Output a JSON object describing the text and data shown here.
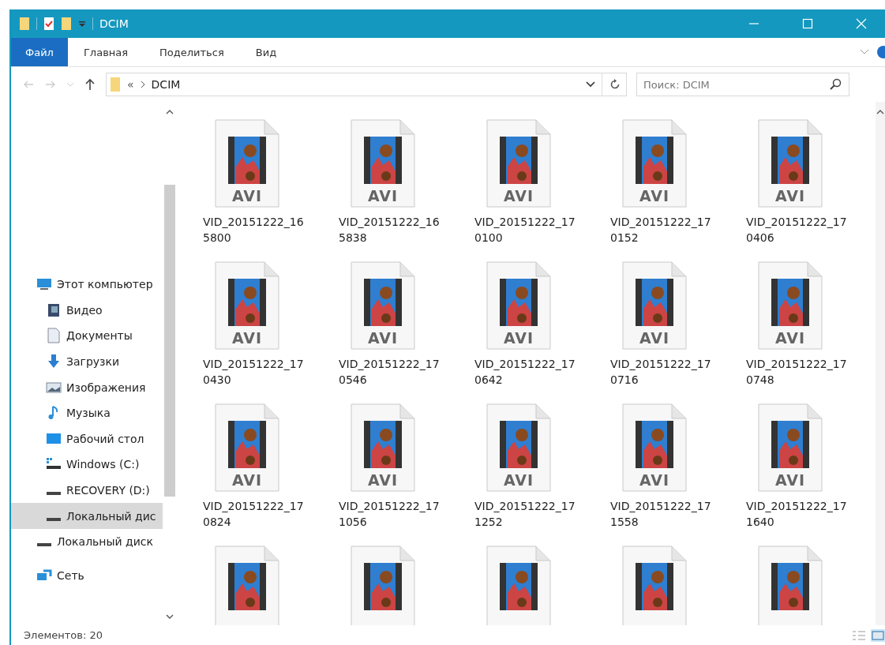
{
  "window": {
    "title": "DCIM"
  },
  "ribbon_tabs": [
    {
      "label": "Файл",
      "selected": true
    },
    {
      "label": "Главная",
      "selected": false
    },
    {
      "label": "Поделиться",
      "selected": false
    },
    {
      "label": "Вид",
      "selected": false
    }
  ],
  "address": {
    "overflow": "«",
    "path": "DCIM"
  },
  "search": {
    "placeholder": "Поиск: DCIM"
  },
  "sidebar": {
    "items": [
      {
        "label": "Этот компьютер",
        "kind": "computer",
        "selected": false,
        "children": [
          {
            "label": "Видео",
            "kind": "video",
            "selected": false
          },
          {
            "label": "Документы",
            "kind": "documents",
            "selected": false
          },
          {
            "label": "Загрузки",
            "kind": "downloads",
            "selected": false
          },
          {
            "label": "Изображения",
            "kind": "pictures",
            "selected": false
          },
          {
            "label": "Музыка",
            "kind": "music",
            "selected": false
          },
          {
            "label": "Рабочий стол",
            "kind": "desktop",
            "selected": false
          },
          {
            "label": "Windows (C:)",
            "kind": "system-drive",
            "selected": false
          },
          {
            "label": "RECOVERY (D:)",
            "kind": "drive",
            "selected": false
          },
          {
            "label": "Локальный дис",
            "kind": "drive",
            "selected": true
          }
        ]
      },
      {
        "label": "Локальный диск",
        "kind": "drive",
        "selected": false
      },
      {
        "label": "Сеть",
        "kind": "network",
        "selected": false
      }
    ]
  },
  "files": [
    {
      "kind": "video",
      "name": "VID_20151222_165800",
      "badge": "AVI"
    },
    {
      "kind": "video",
      "name": "VID_20151222_165838",
      "badge": "AVI"
    },
    {
      "kind": "video",
      "name": "VID_20151222_170100",
      "badge": "AVI"
    },
    {
      "kind": "video",
      "name": "VID_20151222_170152",
      "badge": "AVI"
    },
    {
      "kind": "video",
      "name": "VID_20151222_170406",
      "badge": "AVI"
    },
    {
      "kind": "video",
      "name": "VID_20151222_170430",
      "badge": "AVI"
    },
    {
      "kind": "video",
      "name": "VID_20151222_170546",
      "badge": "AVI"
    },
    {
      "kind": "video",
      "name": "VID_20151222_170642",
      "badge": "AVI"
    },
    {
      "kind": "video",
      "name": "VID_20151222_170716",
      "badge": "AVI"
    },
    {
      "kind": "video",
      "name": "VID_20151222_170748",
      "badge": "AVI"
    },
    {
      "kind": "video",
      "name": "VID_20151222_170824",
      "badge": "AVI"
    },
    {
      "kind": "video",
      "name": "VID_20151222_171056",
      "badge": "AVI"
    },
    {
      "kind": "video",
      "name": "VID_20151222_171252",
      "badge": "AVI"
    },
    {
      "kind": "video",
      "name": "VID_20151222_171558",
      "badge": "AVI"
    },
    {
      "kind": "video",
      "name": "VID_20151222_171640",
      "badge": "AVI"
    },
    {
      "kind": "video"
    },
    {
      "kind": "video"
    },
    {
      "kind": "video"
    },
    {
      "kind": "video"
    },
    {
      "kind": "video"
    }
  ],
  "status_bar": {
    "count": "Элементов: 20"
  }
}
